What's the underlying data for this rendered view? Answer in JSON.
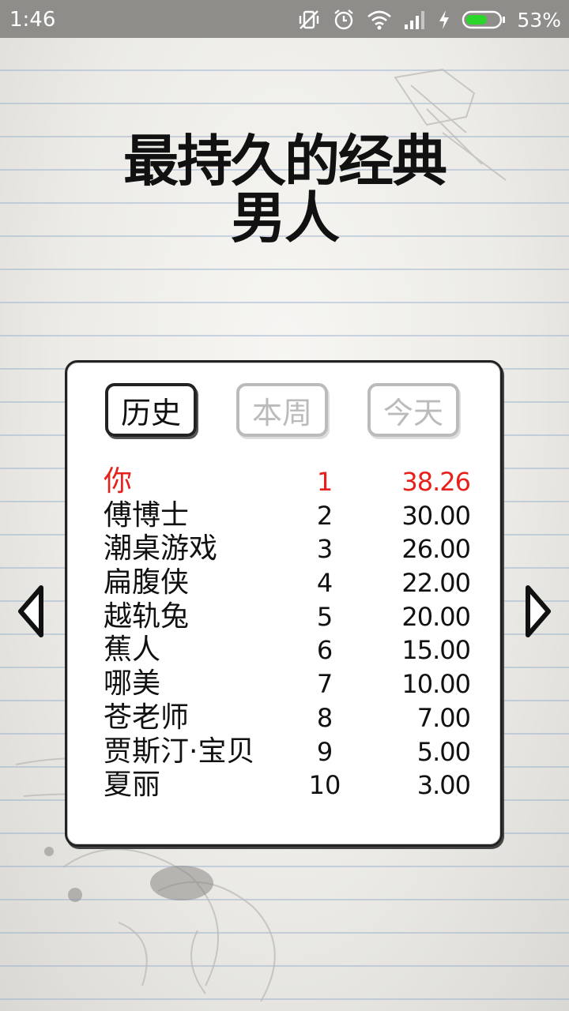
{
  "status_bar": {
    "time": "1:46",
    "battery_percent": "53%"
  },
  "title": {
    "line1": "最持久的经典",
    "line2": "男人"
  },
  "tabs": [
    {
      "label": "历史",
      "active": true
    },
    {
      "label": "本周",
      "active": false
    },
    {
      "label": "今天",
      "active": false
    }
  ],
  "leaderboard": [
    {
      "name": "你",
      "rank": "1",
      "score": "38.26",
      "highlight": true
    },
    {
      "name": "傅博士",
      "rank": "2",
      "score": "30.00"
    },
    {
      "name": "潮桌游戏",
      "rank": "3",
      "score": "26.00"
    },
    {
      "name": "扁腹侠",
      "rank": "4",
      "score": "22.00"
    },
    {
      "name": "越轨兔",
      "rank": "5",
      "score": "20.00"
    },
    {
      "name": "蕉人",
      "rank": "6",
      "score": "15.00"
    },
    {
      "name": "哪美",
      "rank": "7",
      "score": "10.00"
    },
    {
      "name": "苍老师",
      "rank": "8",
      "score": "7.00"
    },
    {
      "name": "贾斯汀·宝贝",
      "rank": "9",
      "score": "5.00"
    },
    {
      "name": "夏丽",
      "rank": "10",
      "score": "3.00"
    }
  ],
  "colors": {
    "highlight": "#e8201c",
    "text": "#111111",
    "inactive_tab": "#bbbbbb",
    "status_bar": "#8e8d8a"
  },
  "icons": {
    "prev": "left-arrow-icon",
    "next": "right-arrow-icon"
  }
}
